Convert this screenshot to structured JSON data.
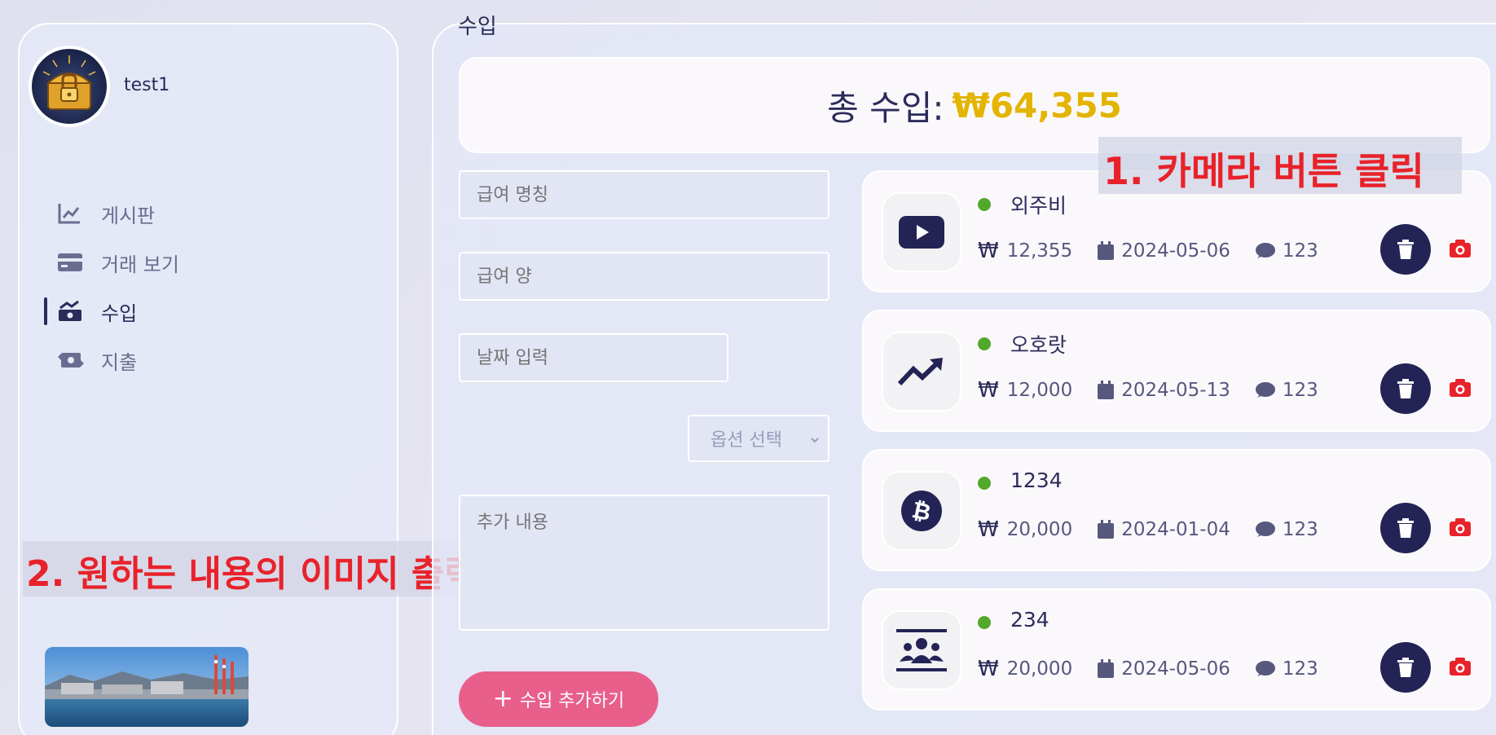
{
  "user": {
    "name": "test1"
  },
  "nav": [
    {
      "label": "게시판",
      "icon": "chart-line-icon",
      "active": false
    },
    {
      "label": "거래 보기",
      "icon": "credit-card-icon",
      "active": false
    },
    {
      "label": "수입",
      "icon": "money-trend-icon",
      "active": true
    },
    {
      "label": "지출",
      "icon": "money-exchange-icon",
      "active": false
    }
  ],
  "section_title": "수입",
  "total": {
    "label": "총 수입:",
    "amount": "₩64,355",
    "amount_color": "#e3b400"
  },
  "form": {
    "name_placeholder": "급여 명칭",
    "amount_placeholder": "급여 양",
    "date_placeholder": "날짜 입력",
    "select_value": "옵션 선택",
    "note_placeholder": "추가 내용",
    "add_button": "수입 추가하기"
  },
  "items": [
    {
      "name": "외주비",
      "amount": "12,355",
      "date": "2024-05-06",
      "comment": "123",
      "icon": "youtube-icon"
    },
    {
      "name": "오호랏",
      "amount": "12,000",
      "date": "2024-05-13",
      "comment": "123",
      "icon": "trend-up-icon"
    },
    {
      "name": "1234",
      "amount": "20,000",
      "date": "2024-01-04",
      "comment": "123",
      "icon": "bitcoin-icon"
    },
    {
      "name": "234",
      "amount": "20,000",
      "date": "2024-05-06",
      "comment": "123",
      "icon": "users-icon"
    }
  ],
  "currency_symbol": "₩",
  "annotations": {
    "step1": "1. 카메라 버튼 클릭",
    "step2": "2. 원하는 내용의 이미지 출력"
  },
  "colors": {
    "accent": "#232455",
    "pink_button": "#e85f8b",
    "status_dot": "#52a82a",
    "camera": "#e8222a"
  }
}
